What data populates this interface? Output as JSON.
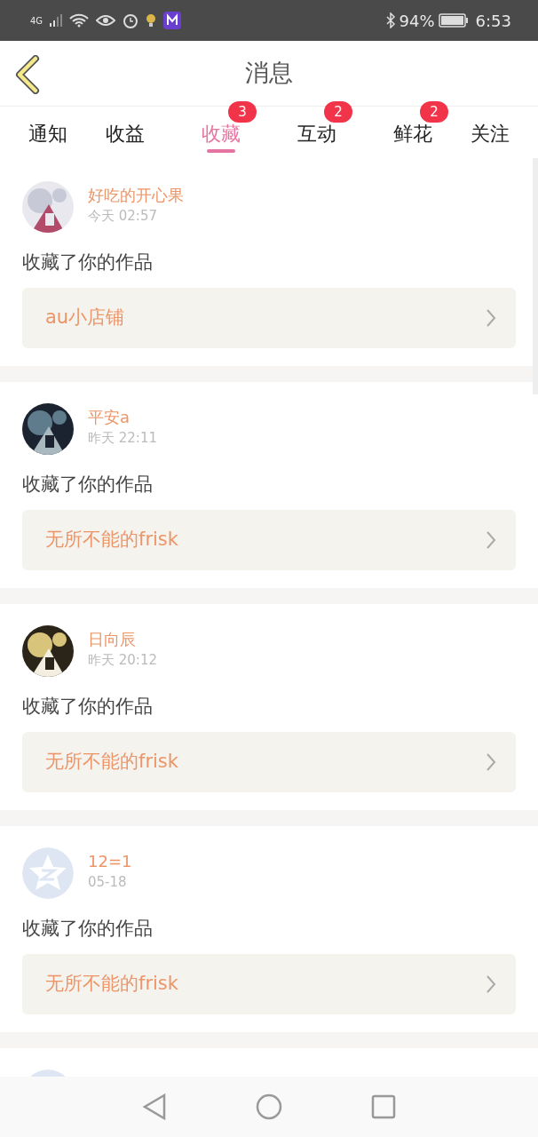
{
  "status_bar": {
    "network": "4G",
    "battery": "94%",
    "time": "6:53"
  },
  "header": {
    "title": "消息"
  },
  "tabs": [
    {
      "label": "通知",
      "selected": false
    },
    {
      "label": "收益",
      "selected": false
    },
    {
      "label": "收藏",
      "selected": true,
      "badge": "3"
    },
    {
      "label": "互动",
      "selected": false,
      "badge": "2"
    },
    {
      "label": "鲜花",
      "selected": false,
      "badge": "2"
    },
    {
      "label": "关注",
      "selected": false
    }
  ],
  "messages": [
    {
      "user": "好吃的开心果",
      "time": "今天 02:57",
      "text": "收藏了你的作品",
      "work": "au小店铺"
    },
    {
      "user": "平安a",
      "time": "昨天 22:11",
      "text": "收藏了你的作品",
      "work": "无所不能的frisk"
    },
    {
      "user": "日向辰",
      "time": "昨天 20:12",
      "text": "收藏了你的作品",
      "work": "无所不能的frisk"
    },
    {
      "avatar": {
        "kind": "default"
      },
      "user": "12=1",
      "time": "05-18",
      "text": "收藏了你的作品",
      "work": "无所不能的frisk"
    },
    {
      "avatar": {
        "kind": "default"
      }
    }
  ]
}
